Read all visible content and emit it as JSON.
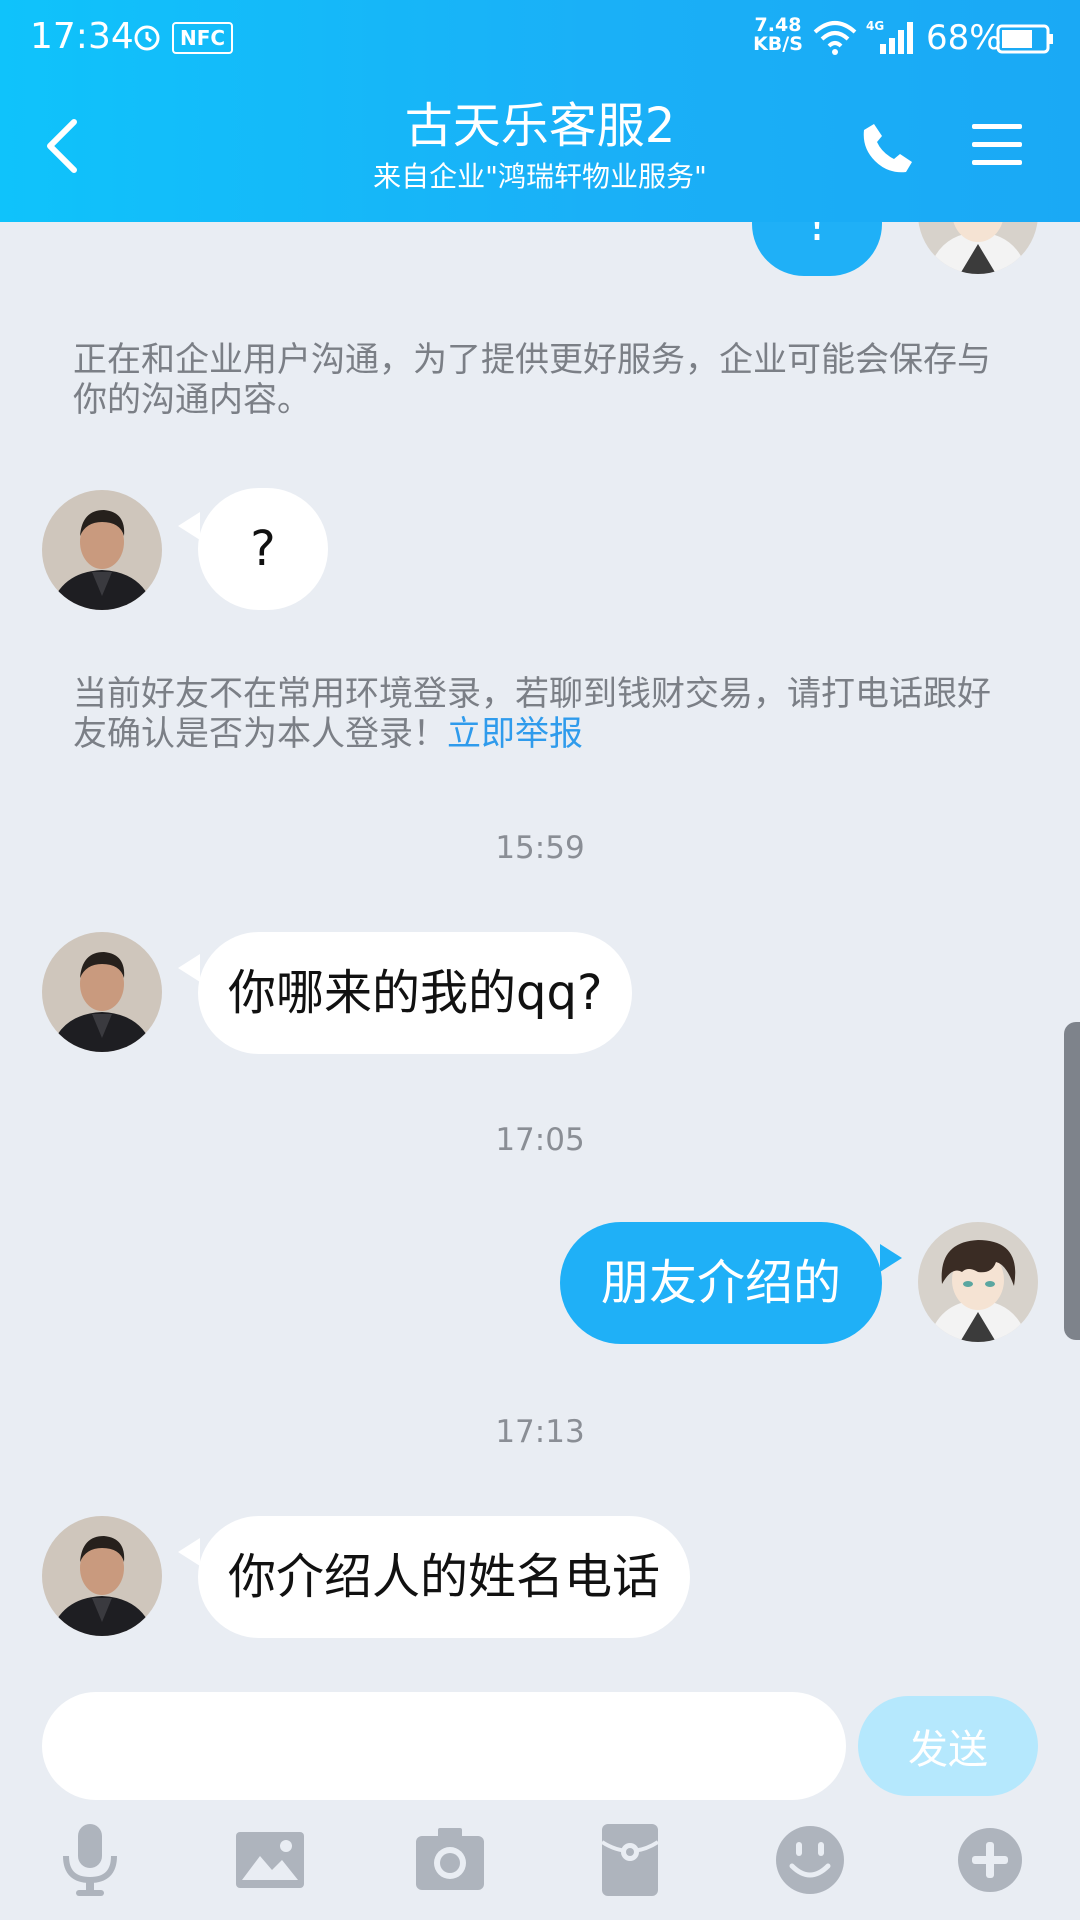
{
  "status_bar": {
    "time": "17:34",
    "nfc": "NFC",
    "net_speed_value": "7.48",
    "net_speed_unit": "KB/S",
    "network": "4G",
    "battery": "68%"
  },
  "header": {
    "title": "古天乐客服2",
    "subtitle": "来自企业\"鸿瑞轩物业服务\""
  },
  "messages": {
    "top_partial": {
      "text": "!"
    },
    "notice_enterprise": "正在和企业用户沟通，为了提供更好服务，企业可能会保存与你的沟通内容。",
    "msg1": {
      "text": "?"
    },
    "notice_security_text": "当前好友不在常用环境登录，若聊到钱财交易，请打电话跟好友确认是否为本人登录！",
    "notice_security_link": "立即举报",
    "time1": "15:59",
    "msg2": {
      "text": "你哪来的我的qq?"
    },
    "time2": "17:05",
    "msg3": {
      "text": "朋友介绍的"
    },
    "time3": "17:13",
    "msg4": {
      "text": "你介绍人的姓名电话"
    }
  },
  "input": {
    "value": "",
    "placeholder": "",
    "send_label": "发送"
  },
  "toolbar": {
    "items": [
      "microphone-icon",
      "image-icon",
      "camera-icon",
      "red-packet-icon",
      "emoji-icon",
      "plus-icon"
    ]
  },
  "colors": {
    "header_start": "#0fc3fb",
    "header_end": "#1aa9f5",
    "chat_background": "#e9edf3",
    "outgoing_bubble": "#1fb0f7",
    "incoming_bubble": "#ffffff",
    "link": "#2f9bec",
    "send_button_disabled": "#b5e8fd",
    "tool_icon": "#aeb4bd"
  }
}
